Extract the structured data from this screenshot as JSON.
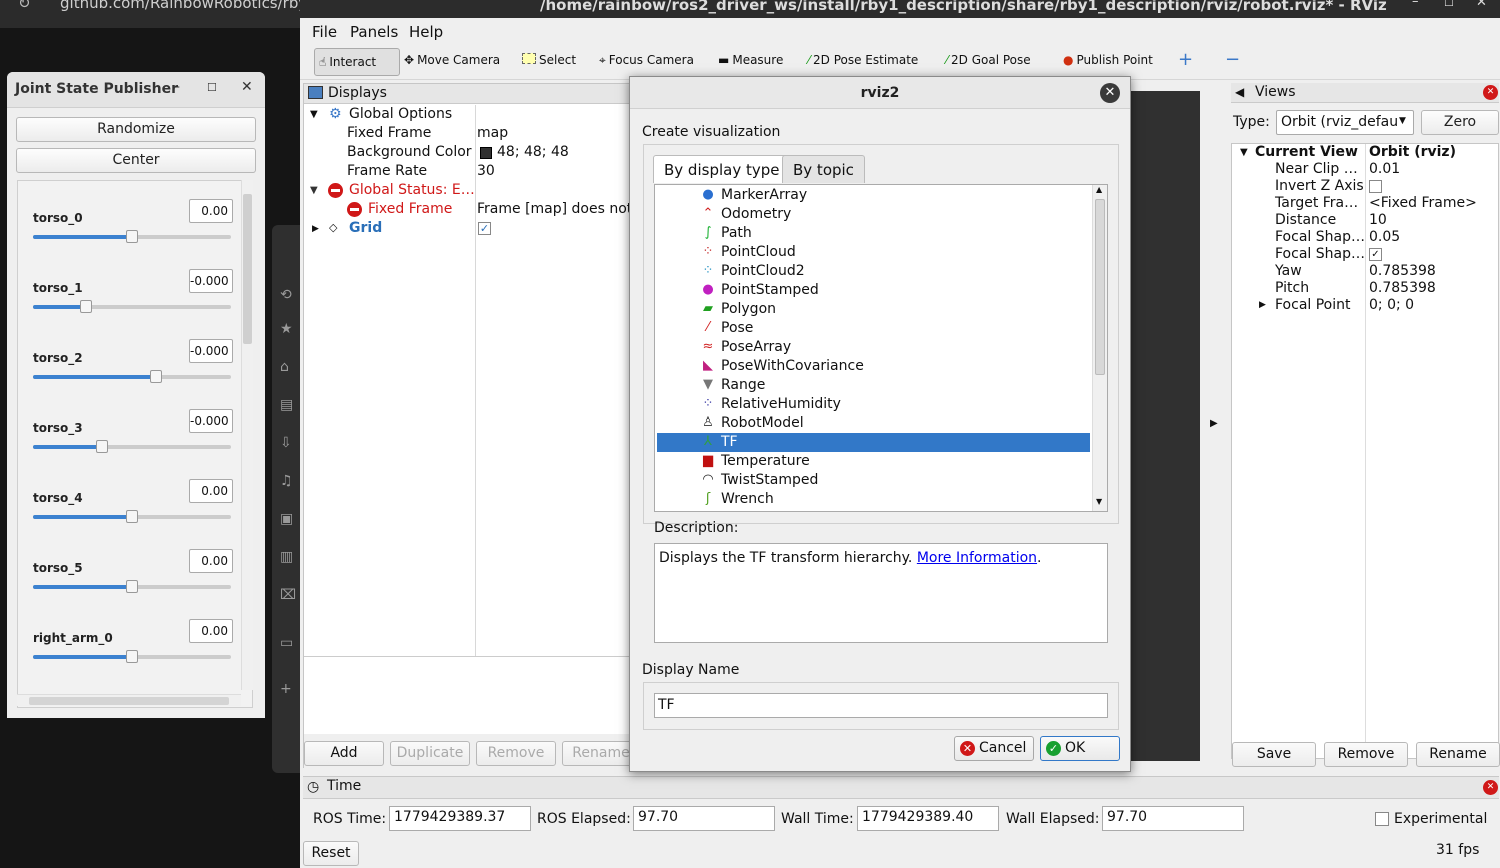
{
  "browser": {
    "url": "github.com/RainbowRobotics/rby"
  },
  "jsp": {
    "title": "Joint State Publisher",
    "randomize": "Randomize",
    "center": "Center",
    "joints": [
      {
        "name": "torso_0",
        "value": "0.00",
        "fraction": 0.5
      },
      {
        "name": "torso_1",
        "value": "-0.000",
        "fraction": 0.27
      },
      {
        "name": "torso_2",
        "value": "-0.000",
        "fraction": 0.62
      },
      {
        "name": "torso_3",
        "value": "-0.000",
        "fraction": 0.35
      },
      {
        "name": "torso_4",
        "value": "0.00",
        "fraction": 0.5
      },
      {
        "name": "torso_5",
        "value": "0.00",
        "fraction": 0.5
      },
      {
        "name": "right_arm_0",
        "value": "0.00",
        "fraction": 0.5
      }
    ]
  },
  "rviz": {
    "title": "/home/rainbow/ros2_driver_ws/install/rby1_description/share/rby1_description/rviz/robot.rviz* - RViz",
    "menu": [
      "File",
      "Panels",
      "Help"
    ],
    "tools": [
      "Interact",
      "Move Camera",
      "Select",
      "Focus Camera",
      "Measure",
      "2D Pose Estimate",
      "2D Goal Pose",
      "Publish Point"
    ],
    "displays": {
      "title": "Displays",
      "global_options": "Global Options",
      "fixed_frame_k": "Fixed Frame",
      "fixed_frame_v": "map",
      "bg_k": "Background Color",
      "bg_v": "48; 48; 48",
      "fr_k": "Frame Rate",
      "fr_v": "30",
      "status_k": "Global Status: E…",
      "ff_err_k": "Fixed Frame",
      "ff_err_v": "Frame [map] does not…",
      "grid": "Grid",
      "buttons": [
        "Add",
        "Duplicate",
        "Remove",
        "Rename"
      ]
    },
    "views": {
      "title": "Views",
      "type_label": "Type:",
      "type_value": "Orbit (rviz_defau",
      "zero": "Zero",
      "rows": [
        {
          "k": "Current View",
          "v": "Orbit (rviz)"
        },
        {
          "k": "Near Clip …",
          "v": "0.01"
        },
        {
          "k": "Invert Z Axis",
          "v": ""
        },
        {
          "k": "Target Fra…",
          "v": "<Fixed Frame>"
        },
        {
          "k": "Distance",
          "v": "10"
        },
        {
          "k": "Focal Shap…",
          "v": "0.05"
        },
        {
          "k": "Focal Shap…",
          "v": "✓"
        },
        {
          "k": "Yaw",
          "v": "0.785398"
        },
        {
          "k": "Pitch",
          "v": "0.785398"
        },
        {
          "k": "Focal Point",
          "v": "0; 0; 0"
        }
      ],
      "buttons": [
        "Save",
        "Remove",
        "Rename"
      ]
    },
    "time": {
      "title": "Time",
      "ros_time_l": "ROS Time:",
      "ros_time": "1779429389.37",
      "ros_el_l": "ROS Elapsed:",
      "ros_el": "97.70",
      "wall_time_l": "Wall Time:",
      "wall_time": "1779429389.40",
      "wall_el_l": "Wall Elapsed:",
      "wall_el": "97.70",
      "experimental": "Experimental",
      "reset": "Reset",
      "fps": "31 fps"
    }
  },
  "dialog": {
    "title": "rviz2",
    "create": "Create visualization",
    "tab_type": "By display type",
    "tab_topic": "By topic",
    "items": [
      {
        "label": "MarkerArray",
        "icon": "marker-array-icon",
        "glyph": "●",
        "color": "#2a6fd0"
      },
      {
        "label": "Odometry",
        "icon": "odometry-icon",
        "glyph": "⌃",
        "color": "#d02020"
      },
      {
        "label": "Path",
        "icon": "path-icon",
        "glyph": "∫",
        "color": "#18b030"
      },
      {
        "label": "PointCloud",
        "icon": "pointcloud-icon",
        "glyph": "⁘",
        "color": "#c02020"
      },
      {
        "label": "PointCloud2",
        "icon": "pointcloud2-icon",
        "glyph": "⁘",
        "color": "#2090c0"
      },
      {
        "label": "PointStamped",
        "icon": "point-stamped-icon",
        "glyph": "●",
        "color": "#c020c0"
      },
      {
        "label": "Polygon",
        "icon": "polygon-icon",
        "glyph": "▰",
        "color": "#20a020"
      },
      {
        "label": "Pose",
        "icon": "pose-icon",
        "glyph": "⁄",
        "color": "#d02020"
      },
      {
        "label": "PoseArray",
        "icon": "pose-array-icon",
        "glyph": "≈",
        "color": "#d02020"
      },
      {
        "label": "PoseWithCovariance",
        "icon": "pose-covariance-icon",
        "glyph": "◣",
        "color": "#c02080"
      },
      {
        "label": "Range",
        "icon": "range-icon",
        "glyph": "▼",
        "color": "#777777"
      },
      {
        "label": "RelativeHumidity",
        "icon": "humidity-icon",
        "glyph": "⁘",
        "color": "#3030a0"
      },
      {
        "label": "RobotModel",
        "icon": "robot-model-icon",
        "glyph": "♙",
        "color": "#333333"
      },
      {
        "label": "TF",
        "icon": "tf-icon",
        "glyph": "⅄",
        "color": "#30a040"
      },
      {
        "label": "Temperature",
        "icon": "temperature-icon",
        "glyph": "▆",
        "color": "#c01010"
      },
      {
        "label": "TwistStamped",
        "icon": "twist-icon",
        "glyph": "◠",
        "color": "#222222"
      },
      {
        "label": "Wrench",
        "icon": "wrench-icon",
        "glyph": "ʃ",
        "color": "#50a020"
      }
    ],
    "selected": "TF",
    "desc_label": "Description:",
    "desc_text": "Displays the TF transform hierarchy.",
    "desc_link": "More Information",
    "desc_end": ".",
    "name_label": "Display Name",
    "name_value": "TF",
    "cancel": "Cancel",
    "ok": "OK"
  }
}
